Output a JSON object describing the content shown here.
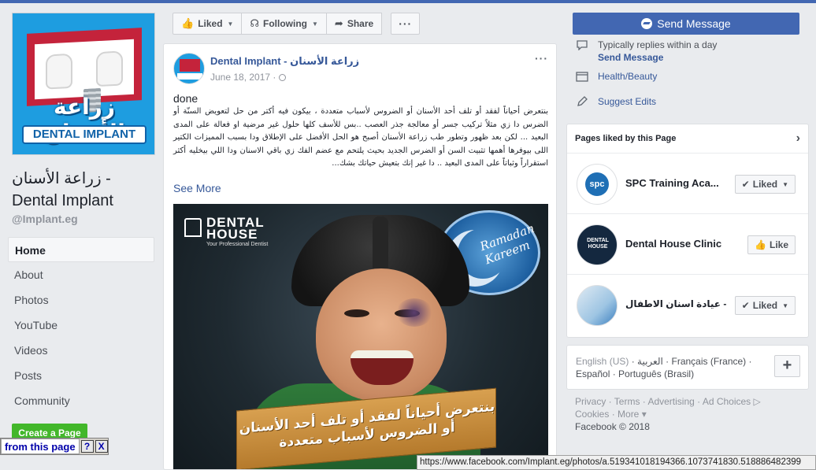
{
  "page": {
    "name": "زراعة الأسنان - Dental Implant",
    "handle": "@Implant.eg",
    "profile_text_ar": "زراعة الأسنان",
    "profile_text_en": "DENTAL IMPLANT"
  },
  "nav": {
    "items": [
      "Home",
      "About",
      "Photos",
      "YouTube",
      "Videos",
      "Posts",
      "Community"
    ],
    "active": "Home",
    "create_page": "Create a Page"
  },
  "extension_bar": {
    "text": "from this page",
    "help": "?",
    "close": "X"
  },
  "actions": {
    "liked": "Liked",
    "following": "Following",
    "share": "Share",
    "more": "···",
    "send_message": "Send Message"
  },
  "post": {
    "author": "Dental Implant - زراعة الأسنان",
    "date": "June 18, 2017 ·",
    "more": "···",
    "first_line": "done",
    "body": "بنتعرض أحياناً لفقد أو تلف أحد الأسنان أو الضروس لأسباب متعددة ، بيكون فيه أكتر من حل لتعويض السنّة أو الضرس دا زي مثلاً تركيب جسر أو معالجة جذر العصب ..بس للأسف كلها حلول غير مرضية او فعالة على المدى البعيد ... لكن بعد ظهور وتطور طب زراعة الأسنان أصبح هو الحل الأفضل على الإطلاق ودا بسبب المميزات الكتير اللى بيوفرها أهمها تثبيت السن أو الضرس الجديد بحيث يلتحم مع عضم الفك زي باقي الاسنان ودا اللي بيخليه أكثر استقراراً وثباتاً على المدى البعيد .. دا غير إنك بتعيش حياتك بشك...",
    "see_more": "See More",
    "image": {
      "logo_title": "DENTAL HOUSE",
      "logo_subtitle": "Your Professional Dentist",
      "badge_text": "Ramadan Kareem",
      "banner_text": "بنتعرض أحياناً لفقد أو تلف أحد الأسنان أو الضروس لأسباب متعددة"
    }
  },
  "about": {
    "response": "Typically replies within a day",
    "send_message_link": "Send Message",
    "category": "Health/Beauty",
    "suggest_edits": "Suggest Edits"
  },
  "liked_pages": {
    "title": "Pages liked by this Page",
    "items": [
      {
        "name": "SPC Training Aca...",
        "button": "Liked",
        "avatar_text": "spc"
      },
      {
        "name": "Dental House Clinic",
        "button": "Like",
        "avatar_text": "DENTAL HOUSE"
      },
      {
        "name": "عيادة اسنان الاطفال - ...inic",
        "button": "Liked",
        "avatar_text": ""
      }
    ]
  },
  "languages": {
    "line1_current": "English (US)",
    "line1_rest": " · العربية · Français (France) ·",
    "line2": "Español · Português (Brasil)",
    "plus": "+"
  },
  "footer": {
    "line1": "Privacy · Terms · Advertising · Ad Choices ▷",
    "line2": "Cookies · More ▾",
    "copyright": "Facebook © 2018"
  },
  "status_bar": {
    "url": "https://www.facebook.com/Implant.eg/photos/a.519341018194366.1073741830.518886482399"
  },
  "colors": {
    "brand": "#4267b2",
    "link": "#365899",
    "create_green": "#42b72a"
  }
}
